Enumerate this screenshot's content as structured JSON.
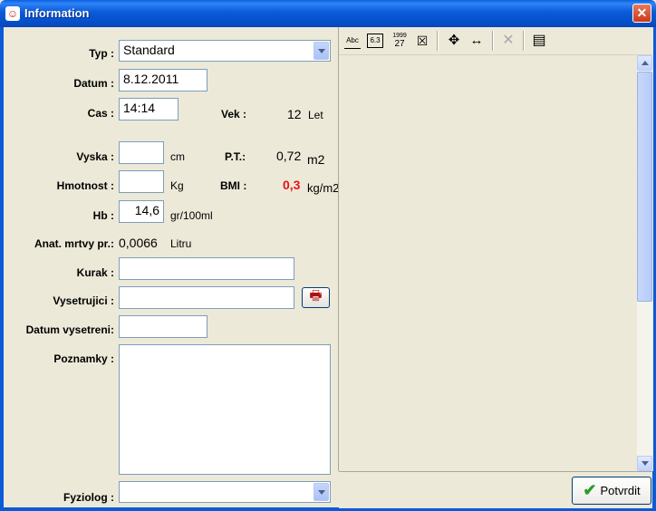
{
  "window": {
    "title": "Information",
    "close": "✕"
  },
  "form": {
    "typ": {
      "label": "Typ :",
      "value": "Standard"
    },
    "datum": {
      "label": "Datum :",
      "value": "8.12.2011"
    },
    "cas": {
      "label": "Cas :",
      "value": "14:14"
    },
    "vek": {
      "label": "Vek :",
      "value": "12",
      "unit": "Let"
    },
    "vyska": {
      "label": "Vyska :",
      "value": "",
      "unit": "cm"
    },
    "pt": {
      "label": "P.T.:",
      "value": "0,72",
      "unit": "m2"
    },
    "hmotnost": {
      "label": "Hmotnost :",
      "value": "",
      "unit": "Kg"
    },
    "bmi": {
      "label": "BMI :",
      "value": "0,3",
      "unit": "kg/m2",
      "color": "#E8101A"
    },
    "hb": {
      "label": "Hb :",
      "value": "14,6",
      "unit": "gr/100ml"
    },
    "anat": {
      "label": "Anat. mrtvy pr.:",
      "value": "0,0066",
      "unit": "Litru"
    },
    "kurak": {
      "label": "Kurak :",
      "value": ""
    },
    "vysetrujici": {
      "label": "Vysetrujici :",
      "value": ""
    },
    "datum_vysetreni": {
      "label": "Datum vysetreni:",
      "value": ""
    },
    "poznamky": {
      "label": "Poznamky :",
      "value": ""
    },
    "fyziolog": {
      "label": "Fyziolog :",
      "value": ""
    }
  },
  "toolbar": {
    "abc": "Abc",
    "num": "6.3",
    "date_top": "1999",
    "date_bottom": "27",
    "clear": "☒",
    "move": "✥",
    "resize": "↔",
    "delete": "✕",
    "list": "▤"
  },
  "buttons": {
    "potvrdit": "Potvrdit",
    "print_icon": "🖶"
  }
}
